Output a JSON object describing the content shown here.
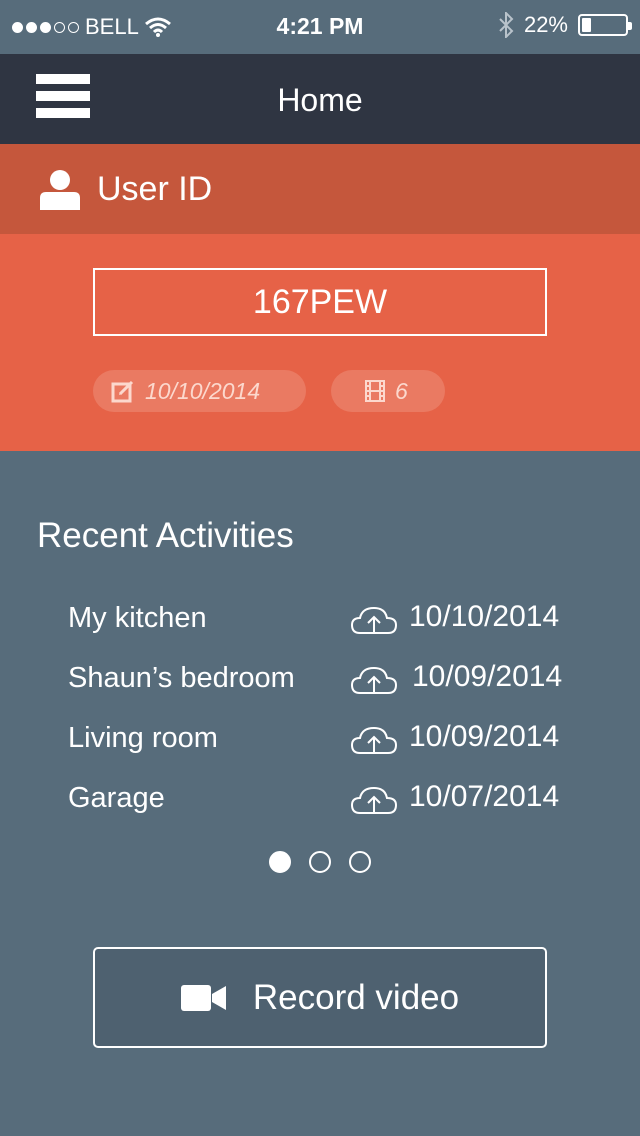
{
  "status_bar": {
    "carrier": "BELL",
    "time": "4:21 PM",
    "battery": "22%",
    "battery_level": 0.22,
    "signal_bars": 3,
    "signal_total": 5
  },
  "navbar": {
    "title": "Home",
    "menu_icon": "hamburger-icon"
  },
  "user": {
    "label": "User ID",
    "id_value": "167PEW",
    "date": "10/10/2014",
    "video_count": "6"
  },
  "activities": {
    "title": "Recent Activities",
    "items": [
      {
        "name": "My kitchen",
        "date": "10/10/2014"
      },
      {
        "name": "Shaun’s bedroom",
        "date": "10/09/2014"
      },
      {
        "name": "Living room",
        "date": "10/09/2014"
      },
      {
        "name": "Garage",
        "date": "10/07/2014"
      }
    ],
    "pages": 3,
    "current_page": 1
  },
  "record_button": {
    "label": "Record video",
    "icon": "video-camera-icon"
  },
  "colors": {
    "background": "#576c7b",
    "navbar": "#2f3542",
    "user_header": "#c5573c",
    "user_panel": "#e66247",
    "accent_text": "#fcd8cd"
  }
}
